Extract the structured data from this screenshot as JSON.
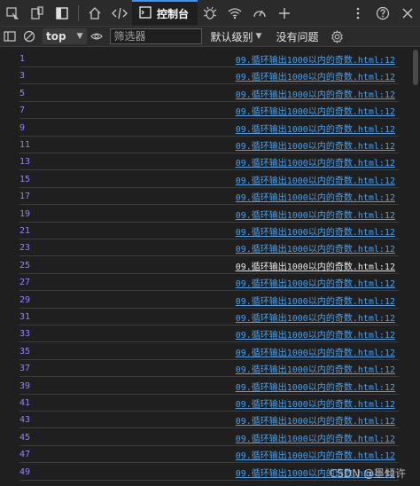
{
  "tabs": {
    "active_label": "控制台"
  },
  "toolbar": {
    "context": "top",
    "filter_placeholder": "筛选器",
    "levels_label": "默认级别",
    "issues_label": "没有问题"
  },
  "console": {
    "rows": [
      {
        "value": "1",
        "source": "09.循环输出1000以内的奇数.html:12"
      },
      {
        "value": "3",
        "source": "09.循环输出1000以内的奇数.html:12"
      },
      {
        "value": "5",
        "source": "09.循环输出1000以内的奇数.html:12"
      },
      {
        "value": "7",
        "source": "09.循环输出1000以内的奇数.html:12"
      },
      {
        "value": "9",
        "source": "09.循环输出1000以内的奇数.html:12"
      },
      {
        "value": "11",
        "source": "09.循环输出1000以内的奇数.html:12"
      },
      {
        "value": "13",
        "source": "09.循环输出1000以内的奇数.html:12"
      },
      {
        "value": "15",
        "source": "09.循环输出1000以内的奇数.html:12"
      },
      {
        "value": "17",
        "source": "09.循环输出1000以内的奇数.html:12"
      },
      {
        "value": "19",
        "source": "09.循环输出1000以内的奇数.html:12"
      },
      {
        "value": "21",
        "source": "09.循环输出1000以内的奇数.html:12"
      },
      {
        "value": "23",
        "source": "09.循环输出1000以内的奇数.html:12"
      },
      {
        "value": "25",
        "source": "09.循环输出1000以内的奇数.html:12"
      },
      {
        "value": "27",
        "source": "09.循环输出1000以内的奇数.html:12"
      },
      {
        "value": "29",
        "source": "09.循环输出1000以内的奇数.html:12"
      },
      {
        "value": "31",
        "source": "09.循环输出1000以内的奇数.html:12"
      },
      {
        "value": "33",
        "source": "09.循环输出1000以内的奇数.html:12"
      },
      {
        "value": "35",
        "source": "09.循环输出1000以内的奇数.html:12"
      },
      {
        "value": "37",
        "source": "09.循环输出1000以内的奇数.html:12"
      },
      {
        "value": "39",
        "source": "09.循环输出1000以内的奇数.html:12"
      },
      {
        "value": "41",
        "source": "09.循环输出1000以内的奇数.html:12"
      },
      {
        "value": "43",
        "source": "09.循环输出1000以内的奇数.html:12"
      },
      {
        "value": "45",
        "source": "09.循环输出1000以内的奇数.html:12"
      },
      {
        "value": "47",
        "source": "09.循环输出1000以内的奇数.html:12"
      },
      {
        "value": "49",
        "source": "09.循环输出1000以内的奇数.html:12"
      }
    ]
  },
  "watermark": "CSDN @墨倾许",
  "colors": {
    "background": "#1f1f1f",
    "number": "#9980ff",
    "link": "#4e9fe6",
    "accent": "#3794ff"
  }
}
